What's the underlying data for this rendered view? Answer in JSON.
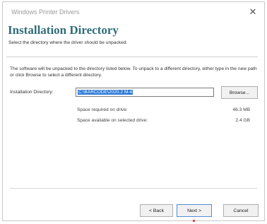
{
  "window": {
    "title": "Windows Printer Drivers",
    "close_glyph": "✕"
  },
  "header": {
    "title": "Installation Directory",
    "subtitle": "Select the directory where the driver should be unpacked."
  },
  "description": "The software will be unpacked to the directory listed below.  To unpack to a different directory, either type in the new path or click Browse to select a different directory.",
  "install_dir": {
    "label": "Installation Directory:",
    "value": "C:\\BARCODE\\2020.2 M-4"
  },
  "browse_label": "Browse...",
  "space": {
    "required_label": "Space required on drive:",
    "required_value": "46.3 MB",
    "available_label": "Space available on selected drive:",
    "available_value": "2.4 GB"
  },
  "nav": {
    "back_label": "< Back",
    "next_label": "Next >",
    "cancel_label": "Cancel"
  }
}
